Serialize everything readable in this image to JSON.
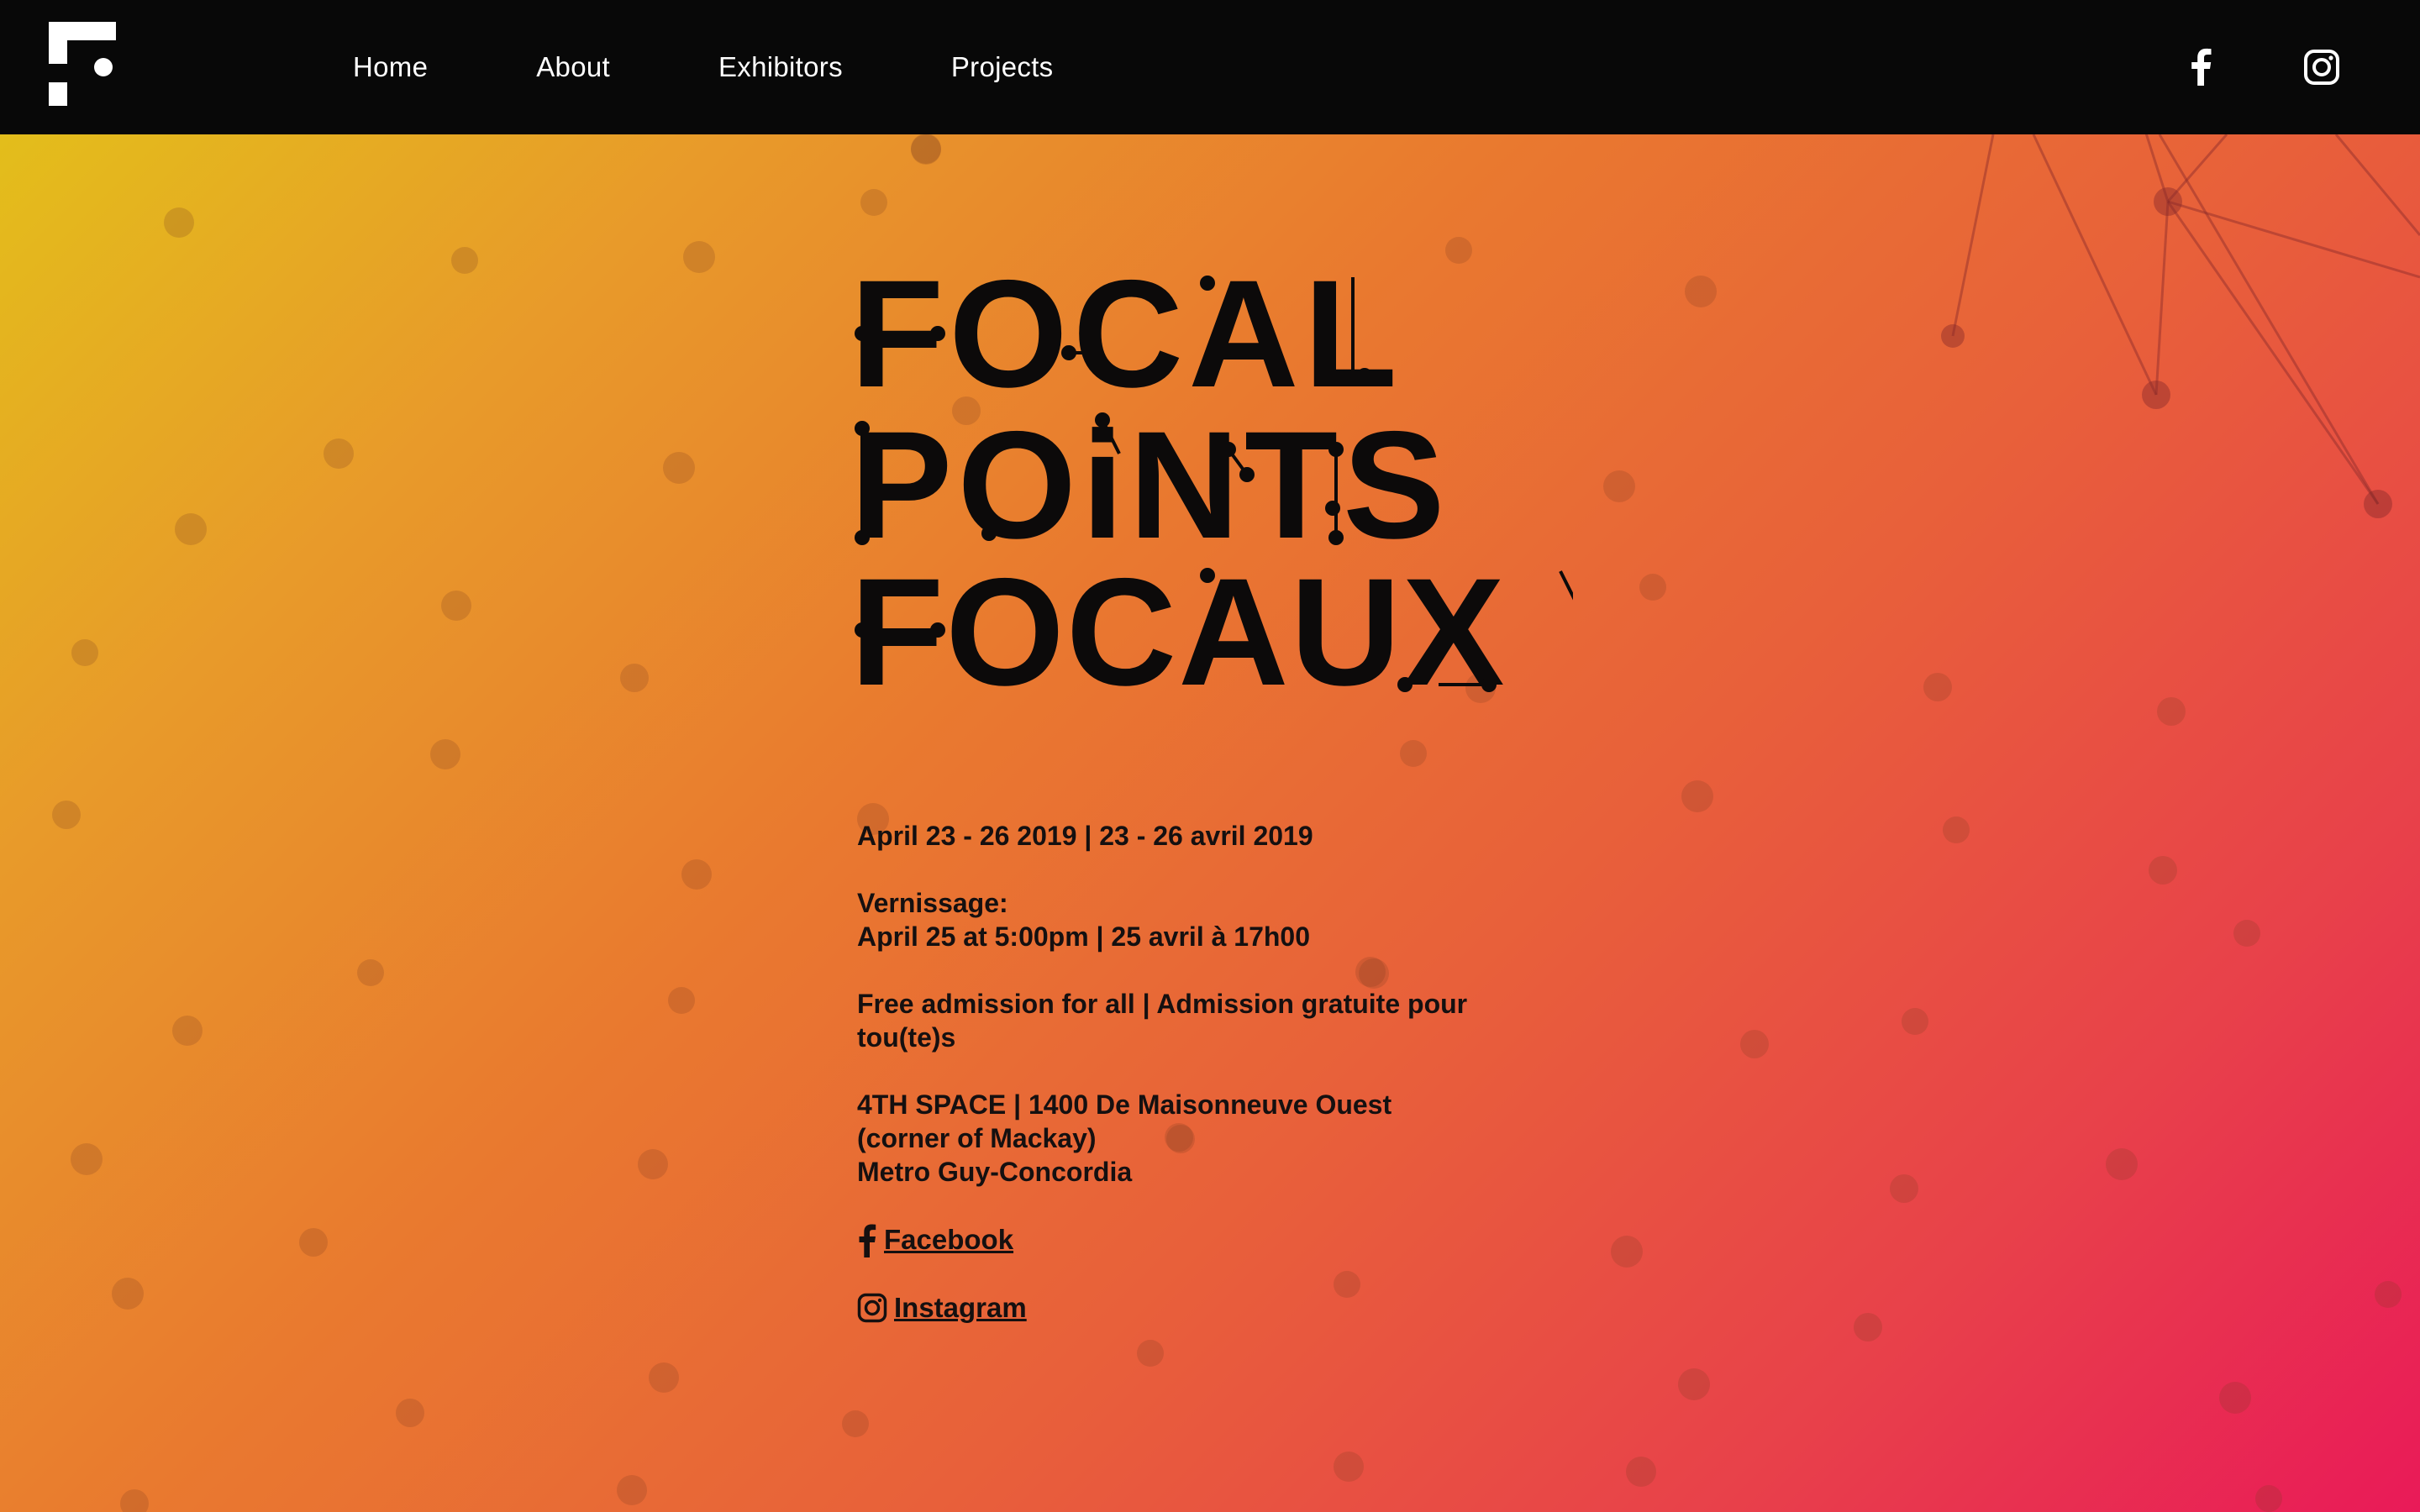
{
  "nav": {
    "items": [
      {
        "label": "Home"
      },
      {
        "label": "About"
      },
      {
        "label": "Exhibitors"
      },
      {
        "label": "Projects"
      }
    ]
  },
  "hero": {
    "title_lines": [
      "FOCAL",
      "POiNTS",
      "FOCAUX"
    ]
  },
  "info": {
    "dates": "April 23 - 26 2019 | 23 - 26 avril 2019",
    "vernissage_label": "Vernissage:",
    "vernissage_time": "April 25 at 5:00pm | 25 avril à 17h00",
    "admission": "Free admission for all | Admission gratuite pour tou(te)s",
    "address_line1": "4TH SPACE | 1400 De Maisonneuve Ouest",
    "address_line2": "(corner of Mackay)",
    "address_line3": "Metro Guy-Concordia"
  },
  "links": {
    "facebook": "Facebook",
    "instagram": "Instagram"
  },
  "icons": {
    "logo": "focal-points-logo",
    "facebook": "facebook-icon",
    "instagram": "instagram-icon"
  },
  "colors": {
    "topbar": "#080808",
    "gradient_start": "#e2c418",
    "gradient_mid": "#e9792f",
    "gradient_end": "#e91a58",
    "text": "#151010"
  }
}
